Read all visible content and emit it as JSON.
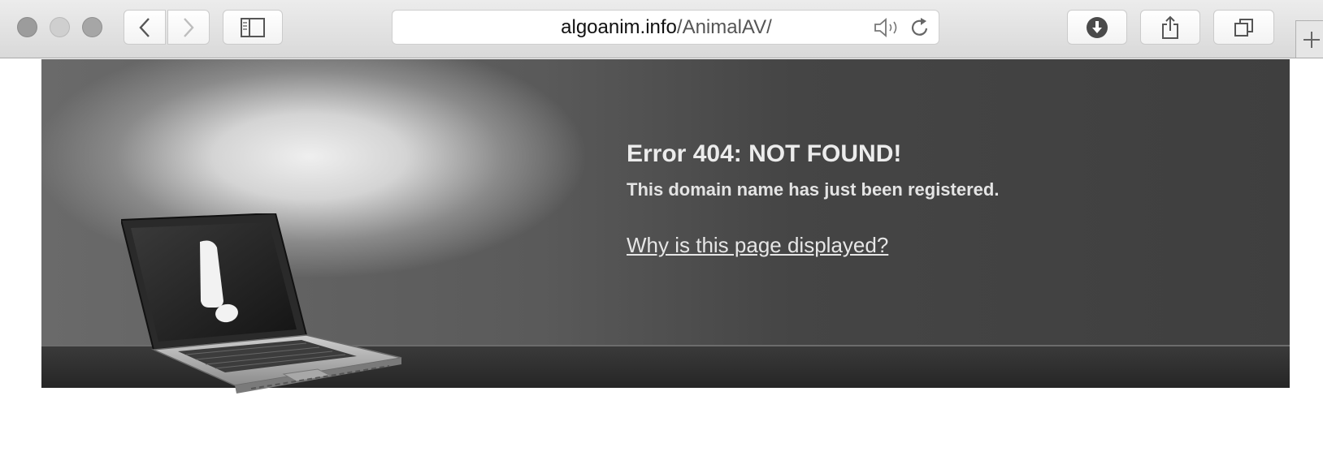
{
  "browser": {
    "url_domain": "algoanim.info",
    "url_path": "/AnimalAV/",
    "icons": {
      "back": "chevron-left-icon",
      "forward": "chevron-right-icon",
      "sidebar": "sidebar-icon",
      "audio": "speaker-icon",
      "reload": "reload-icon",
      "download": "download-icon",
      "share": "share-icon",
      "tabs": "tabs-icon",
      "new_tab": "plus-icon"
    }
  },
  "page": {
    "error_title": "Error 404: NOT FOUND!",
    "error_subtitle": "This domain name has just been registered.",
    "why_link": "Why is this page displayed?",
    "illustration": "laptop-warning-icon"
  }
}
